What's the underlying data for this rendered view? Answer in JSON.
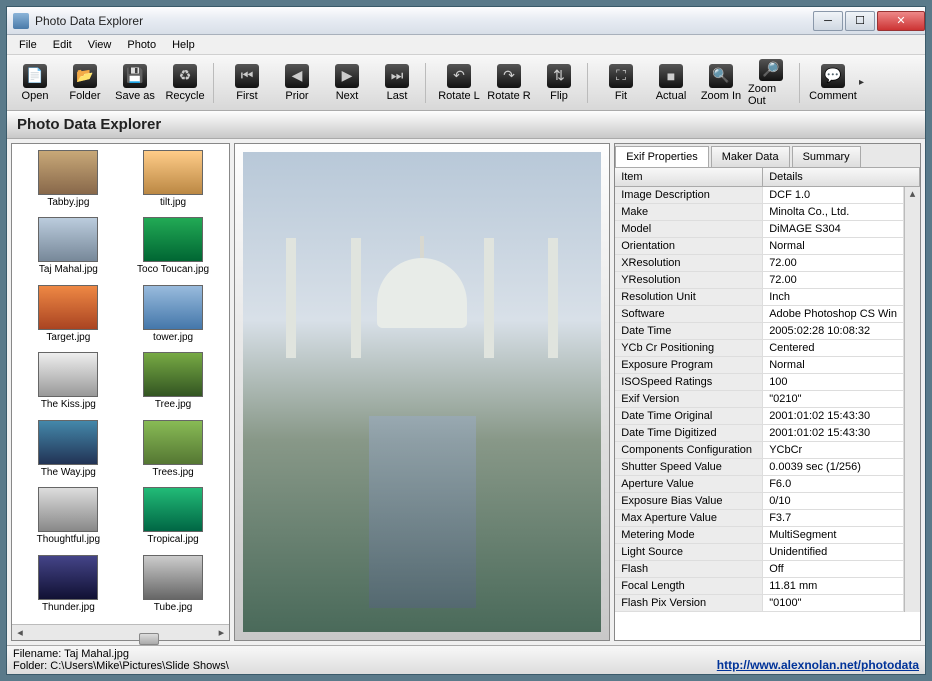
{
  "titlebar": {
    "title": "Photo Data Explorer"
  },
  "menubar": [
    "File",
    "Edit",
    "View",
    "Photo",
    "Help"
  ],
  "toolbar": {
    "groups": [
      [
        {
          "id": "open",
          "label": "Open",
          "glyph": "📄"
        },
        {
          "id": "folder",
          "label": "Folder",
          "glyph": "📂"
        },
        {
          "id": "saveas",
          "label": "Save as",
          "glyph": "💾"
        },
        {
          "id": "recycle",
          "label": "Recycle",
          "glyph": "♻"
        }
      ],
      [
        {
          "id": "first",
          "label": "First",
          "glyph": "⏮"
        },
        {
          "id": "prior",
          "label": "Prior",
          "glyph": "◀"
        },
        {
          "id": "next",
          "label": "Next",
          "glyph": "▶"
        },
        {
          "id": "last",
          "label": "Last",
          "glyph": "⏭"
        }
      ],
      [
        {
          "id": "rotatel",
          "label": "Rotate L",
          "glyph": "↶"
        },
        {
          "id": "rotater",
          "label": "Rotate R",
          "glyph": "↷"
        },
        {
          "id": "flip",
          "label": "Flip",
          "glyph": "⇅"
        }
      ],
      [
        {
          "id": "fit",
          "label": "Fit",
          "glyph": "⛶"
        },
        {
          "id": "actual",
          "label": "Actual",
          "glyph": "■"
        },
        {
          "id": "zoomin",
          "label": "Zoom In",
          "glyph": "🔍"
        },
        {
          "id": "zoomout",
          "label": "Zoom Out",
          "glyph": "🔎"
        }
      ],
      [
        {
          "id": "comment",
          "label": "Comment",
          "glyph": "💬"
        }
      ]
    ]
  },
  "header": {
    "title": "Photo Data Explorer"
  },
  "thumbs": [
    {
      "label": "Tabby.jpg",
      "bg": "linear-gradient(#c8a878,#88684a)"
    },
    {
      "label": "tilt.jpg",
      "bg": "linear-gradient(#fc8,#b84)"
    },
    {
      "label": "Taj Mahal.jpg",
      "bg": "linear-gradient(#bcd,#789)"
    },
    {
      "label": "Toco Toucan.jpg",
      "bg": "linear-gradient(#2a5,#063)"
    },
    {
      "label": "Target.jpg",
      "bg": "linear-gradient(#e84,#a42)"
    },
    {
      "label": "tower.jpg",
      "bg": "linear-gradient(#9bd,#47a)"
    },
    {
      "label": "The Kiss.jpg",
      "bg": "linear-gradient(#eee,#999)"
    },
    {
      "label": "Tree.jpg",
      "bg": "linear-gradient(#7a4,#352)"
    },
    {
      "label": "The Way.jpg",
      "bg": "linear-gradient(#48a,#235)"
    },
    {
      "label": "Trees.jpg",
      "bg": "linear-gradient(#8b5,#573)"
    },
    {
      "label": "Thoughtful.jpg",
      "bg": "linear-gradient(#ddd,#888)"
    },
    {
      "label": "Tropical.jpg",
      "bg": "linear-gradient(#2b7,#064)"
    },
    {
      "label": "Thunder.jpg",
      "bg": "linear-gradient(#448,#113)"
    },
    {
      "label": "Tube.jpg",
      "bg": "linear-gradient(#ccc,#666)"
    }
  ],
  "tabs": [
    {
      "id": "exif",
      "label": "Exif Properties",
      "active": true
    },
    {
      "id": "maker",
      "label": "Maker Data",
      "active": false
    },
    {
      "id": "summary",
      "label": "Summary",
      "active": false
    }
  ],
  "exif_headers": {
    "item": "Item",
    "details": "Details"
  },
  "exif": [
    {
      "item": "Image Description",
      "details": "DCF 1.0"
    },
    {
      "item": "Make",
      "details": "Minolta Co., Ltd."
    },
    {
      "item": "Model",
      "details": "DiMAGE S304"
    },
    {
      "item": "Orientation",
      "details": "Normal"
    },
    {
      "item": "XResolution",
      "details": "72.00"
    },
    {
      "item": "YResolution",
      "details": "72.00"
    },
    {
      "item": "Resolution Unit",
      "details": "Inch"
    },
    {
      "item": "Software",
      "details": "Adobe Photoshop CS Win"
    },
    {
      "item": "Date Time",
      "details": "2005:02:28 10:08:32"
    },
    {
      "item": "YCb Cr Positioning",
      "details": "Centered"
    },
    {
      "item": "Exposure Program",
      "details": "Normal"
    },
    {
      "item": "ISOSpeed Ratings",
      "details": "100"
    },
    {
      "item": "Exif Version",
      "details": "\"0210\""
    },
    {
      "item": "Date Time Original",
      "details": "2001:01:02 15:43:30"
    },
    {
      "item": "Date Time Digitized",
      "details": "2001:01:02 15:43:30"
    },
    {
      "item": "Components Configuration",
      "details": "YCbCr"
    },
    {
      "item": "Shutter Speed Value",
      "details": "0.0039 sec (1/256)"
    },
    {
      "item": "Aperture Value",
      "details": "F6.0"
    },
    {
      "item": "Exposure Bias Value",
      "details": "0/10"
    },
    {
      "item": "Max Aperture Value",
      "details": "F3.7"
    },
    {
      "item": "Metering Mode",
      "details": "MultiSegment"
    },
    {
      "item": "Light Source",
      "details": "Unidentified"
    },
    {
      "item": "Flash",
      "details": "Off"
    },
    {
      "item": "Focal Length",
      "details": "11.81 mm"
    },
    {
      "item": "Flash Pix Version",
      "details": "\"0100\""
    }
  ],
  "status": {
    "filename_label": "Filename: ",
    "filename": "Taj Mahal.jpg",
    "folder_label": "Folder: ",
    "folder": "C:\\Users\\Mike\\Pictures\\Slide Shows\\",
    "link": "http://www.alexnolan.net/photodata"
  }
}
